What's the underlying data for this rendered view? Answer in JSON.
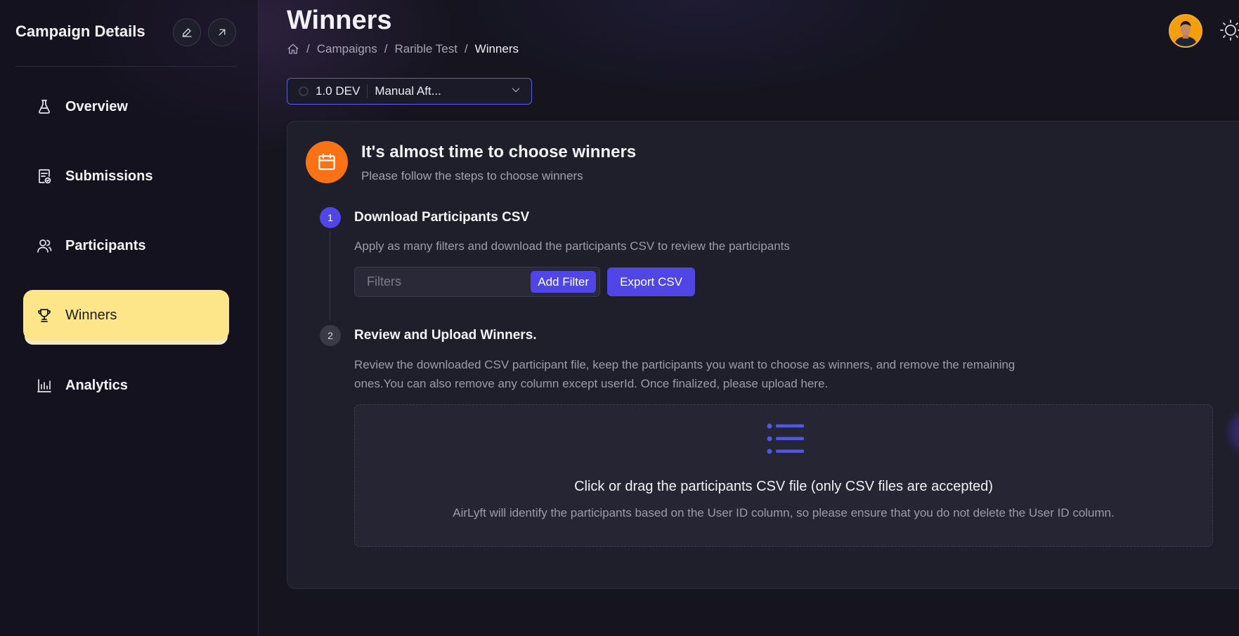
{
  "sidebar": {
    "title": "Campaign Details",
    "edit_icon": "pencil-icon",
    "open_icon": "arrow-up-right-icon",
    "items": [
      {
        "label": "Overview",
        "icon": "flask-icon"
      },
      {
        "label": "Submissions",
        "icon": "document-check-icon"
      },
      {
        "label": "Participants",
        "icon": "users-icon"
      },
      {
        "label": "Winners",
        "icon": "trophy-icon",
        "active": true
      },
      {
        "label": "Analytics",
        "icon": "bar-chart-icon"
      }
    ]
  },
  "header": {
    "title": "Winners",
    "breadcrumb": [
      "Campaigns",
      "Rarible Test",
      "Winners"
    ]
  },
  "version_select": {
    "version": "1.0 DEV",
    "selected": "Manual Aft..."
  },
  "card": {
    "title": "It's almost time to choose winners",
    "subtitle": "Please follow the steps to choose winners",
    "steps": [
      {
        "number": "1",
        "title": "Download Participants CSV",
        "description": "Apply as many filters and download the participants CSV to review the participants"
      },
      {
        "number": "2",
        "title": "Review and Upload Winners.",
        "description_line1": "Review the downloaded CSV participant file, keep the participants you want to choose as winners, and remove the remaining",
        "description_line2": "ones.You can also remove any column except userId. Once finalized, please upload here."
      }
    ],
    "filters_placeholder": "Filters",
    "add_filter_label": "Add Filter",
    "export_label": "Export CSV",
    "dropzone": {
      "title": "Click or drag the participants CSV file (only CSV files are accepted)",
      "subtitle": "AirLyft will identify the participants based on the User ID column, so please ensure that you do not delete the User ID column."
    }
  },
  "colors": {
    "accent": "#4f46e5",
    "active_nav": "#fde68a",
    "calendar_badge": "#f97316",
    "background": "#15141f"
  }
}
